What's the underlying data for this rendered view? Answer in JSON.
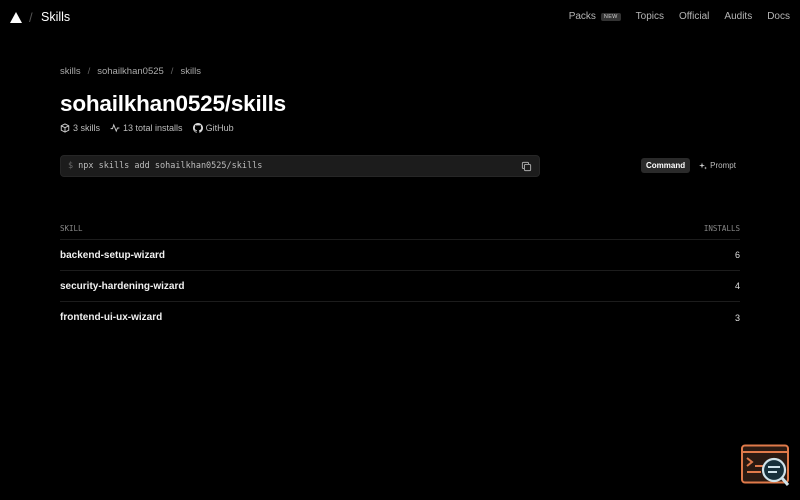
{
  "header": {
    "brand": "Skills",
    "slash": "/",
    "nav": [
      {
        "label": "Packs",
        "badge": "NEW"
      },
      {
        "label": "Topics"
      },
      {
        "label": "Official"
      },
      {
        "label": "Audits"
      },
      {
        "label": "Docs"
      }
    ]
  },
  "breadcrumb": [
    "skills",
    "sohailkhan0525",
    "skills"
  ],
  "breadcrumb_sep": "/",
  "page": {
    "title": "sohailkhan0525/skills",
    "skills_count": "3 skills",
    "installs": "13 total installs",
    "github": "GitHub"
  },
  "command": {
    "prompt": "$",
    "text": "npx skills add sohailkhan0525/skills"
  },
  "mode_toggle": {
    "command_label": "Command",
    "prompt_label": "Prompt"
  },
  "table": {
    "columns": [
      "SKILL",
      "INSTALLS"
    ],
    "rows": [
      {
        "name": "backend-setup-wizard",
        "installs": "6"
      },
      {
        "name": "security-hardening-wizard",
        "installs": "4"
      },
      {
        "name": "frontend-ui-ux-wizard",
        "installs": "3"
      }
    ]
  },
  "colors": {
    "background": "#000000",
    "text": "#ededed",
    "command_bg": "#1c1c1c",
    "widget_accent": "#e07a4a"
  }
}
